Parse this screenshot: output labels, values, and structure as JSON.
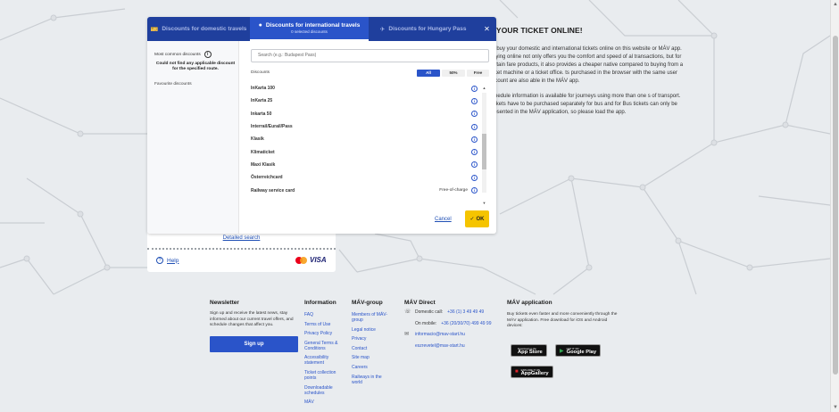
{
  "modal": {
    "tabs": [
      {
        "label": "Discounts for domestic travels",
        "icon": "ticket-icon"
      },
      {
        "label": "Discounts for international travels",
        "sub": "0 selected discounts",
        "icon": "globe-icon"
      },
      {
        "label": "Discounts for Hungary Pass",
        "icon": "pass-icon"
      }
    ],
    "close": "✕",
    "left": {
      "most_common": "Most common discounts",
      "not_found": "Could not find any applicable discount for the specified route.",
      "favourite": "Favourite discounts"
    },
    "search_placeholder": "Search (e.g.: Budapest Pass)",
    "discounts_label": "Discounts",
    "filters": {
      "all": "All",
      "p50": "50%",
      "free": "Free"
    },
    "items": [
      {
        "name": "InKarta 100",
        "extra": ""
      },
      {
        "name": "InKarta 25",
        "extra": ""
      },
      {
        "name": "Inkarta 50",
        "extra": ""
      },
      {
        "name": "Interrail/Eurail/Pass",
        "extra": ""
      },
      {
        "name": "Klasik",
        "extra": ""
      },
      {
        "name": "Klimaticket",
        "extra": ""
      },
      {
        "name": "Maxi Klasik",
        "extra": ""
      },
      {
        "name": "Österreichcard",
        "extra": ""
      },
      {
        "name": "Railway service card",
        "extra": "Free-of-charge"
      }
    ],
    "cancel": "Cancel",
    "ok": "OK"
  },
  "panel": {
    "detailed_search": "Detailed search",
    "help": "Help",
    "visa": "VISA"
  },
  "info": {
    "title": "Y YOUR TICKET ONLINE!",
    "p1": "an buy your domestic and international tickets online on this website or MÁV app. Buying online not only offers you the comfort and speed of al transactions, but for certain fare products, it also provides a cheaper native compared to buying from a ticket machine or a ticket office. ts purchased in the browser with the same user account are also able in the MÁV app.",
    "p2": "schedule information is available for journeys using more than one s of transport. Tickets have to be purchased separately for bus and for Bus tickets can only be presented in the MÁV application, so please load the app."
  },
  "footer": {
    "newsletter": {
      "title": "Newsletter",
      "text": "Sign up and receive the latest news, stay informed about our current travel offers, and schedule changes that affect you.",
      "button": "Sign up"
    },
    "information": {
      "title": "Information",
      "links": [
        "FAQ",
        "Terms of Use",
        "Privacy Policy",
        "General Terms & Conditions",
        "Accessibility statement",
        "Ticket collection points",
        "Downloadable schedules",
        "MÁV"
      ]
    },
    "mavgroup": {
      "title": "MÁV-group",
      "links": [
        "Members of MÁV-group",
        "Legal notice",
        "Privacy",
        "Contact",
        "Site map",
        "Careers",
        "Railways in the world"
      ]
    },
    "direct": {
      "title": "MÁV Direct",
      "domestic_label": "Domestic call:",
      "domestic": "+36 (1) 3 49 49 49",
      "mobile_label": "On mobile:",
      "mobile": "+36 (20/30/70) 499 49 99",
      "email1": "informacio@mav-start.hu",
      "email2": "eszrevetel@mav-start.hu"
    },
    "app": {
      "title": "MÁV application",
      "text": "Buy tickets even faster and more conveniently through the MÁV application. Free download for iOS and Android devices:",
      "appstore_small": "Download on the",
      "appstore": "App Store",
      "gplay_small": "GET IT ON",
      "gplay": "Google Play",
      "gallery_small": "EXPLORE IT ON",
      "gallery": "AppGallery"
    }
  }
}
